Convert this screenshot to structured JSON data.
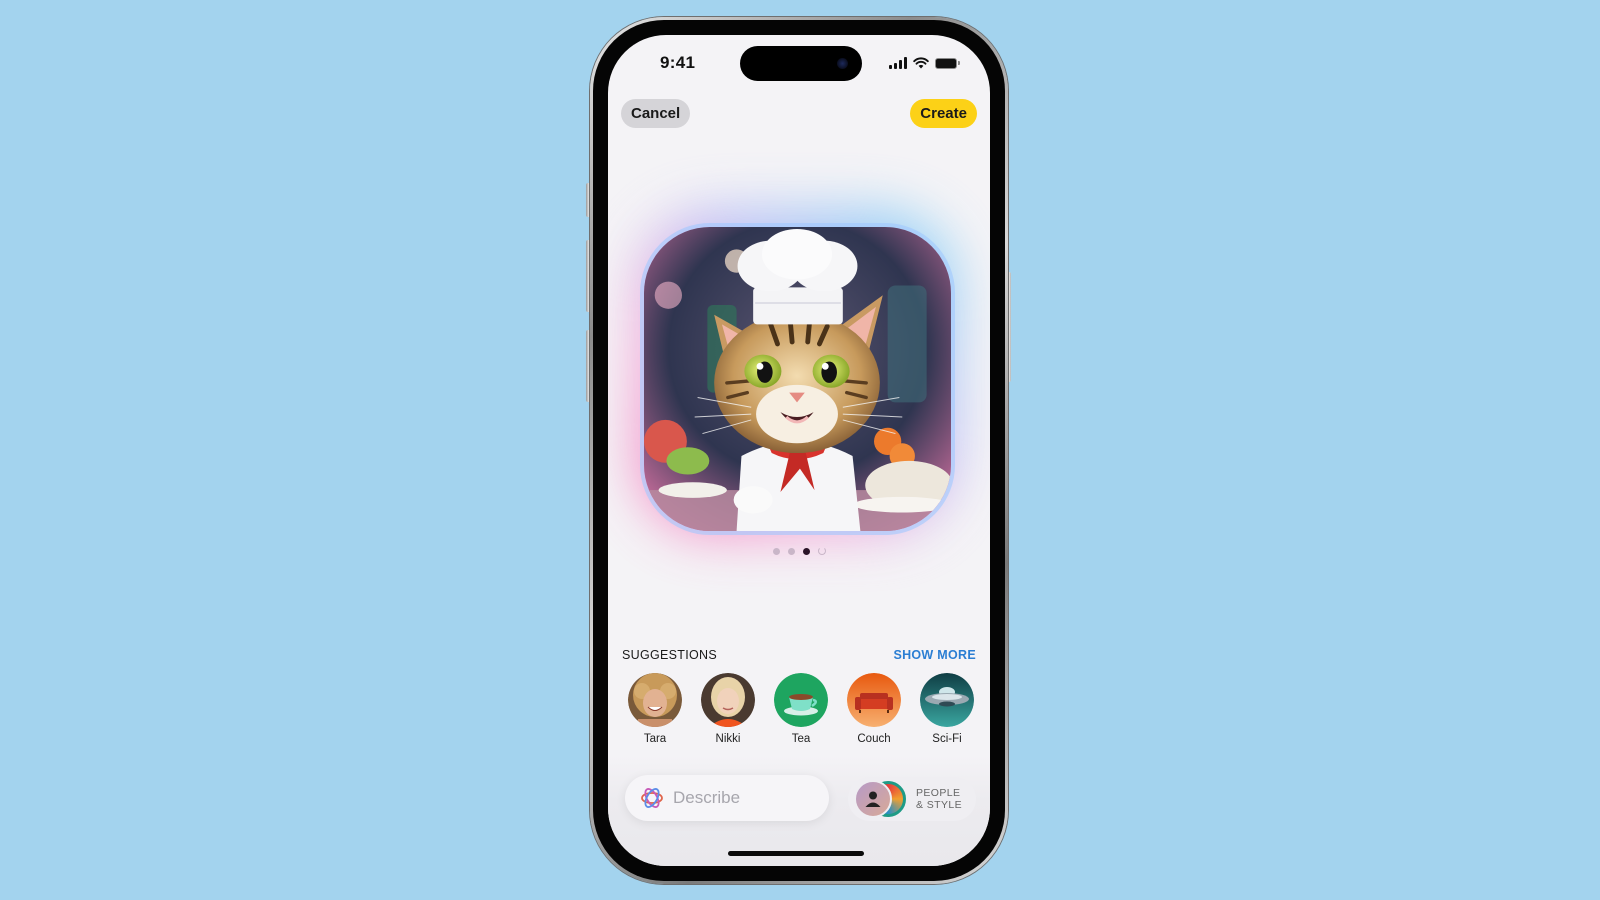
{
  "status_bar": {
    "time": "9:41",
    "icons": [
      "cellular-signal-icon",
      "wifi-icon",
      "battery-icon"
    ]
  },
  "nav": {
    "cancel_label": "Cancel",
    "create_label": "Create"
  },
  "preview": {
    "subject": "Cat chef wearing a white chef hat and red neckerchief",
    "pager": {
      "total_dots": 3,
      "active_index": 2,
      "extra": "refresh-icon"
    }
  },
  "suggestions": {
    "title": "SUGGESTIONS",
    "show_more_label": "SHOW MORE",
    "items": [
      {
        "label": "Tara",
        "icon": "person-photo"
      },
      {
        "label": "Nikki",
        "icon": "person-photo"
      },
      {
        "label": "Tea",
        "icon": "teacup-icon"
      },
      {
        "label": "Couch",
        "icon": "couch-icon"
      },
      {
        "label": "Sci-Fi",
        "icon": "ufo-icon"
      }
    ]
  },
  "bottom_bar": {
    "describe_placeholder": "Describe",
    "people_style_line1": "PEOPLE",
    "people_style_line2": "& STYLE"
  },
  "colors": {
    "background": "#a3d3ee",
    "create_button": "#fcd117",
    "show_more": "#2b7ed3",
    "glow_pink": "#f76bb2",
    "glow_blue": "#6fd3f6"
  }
}
